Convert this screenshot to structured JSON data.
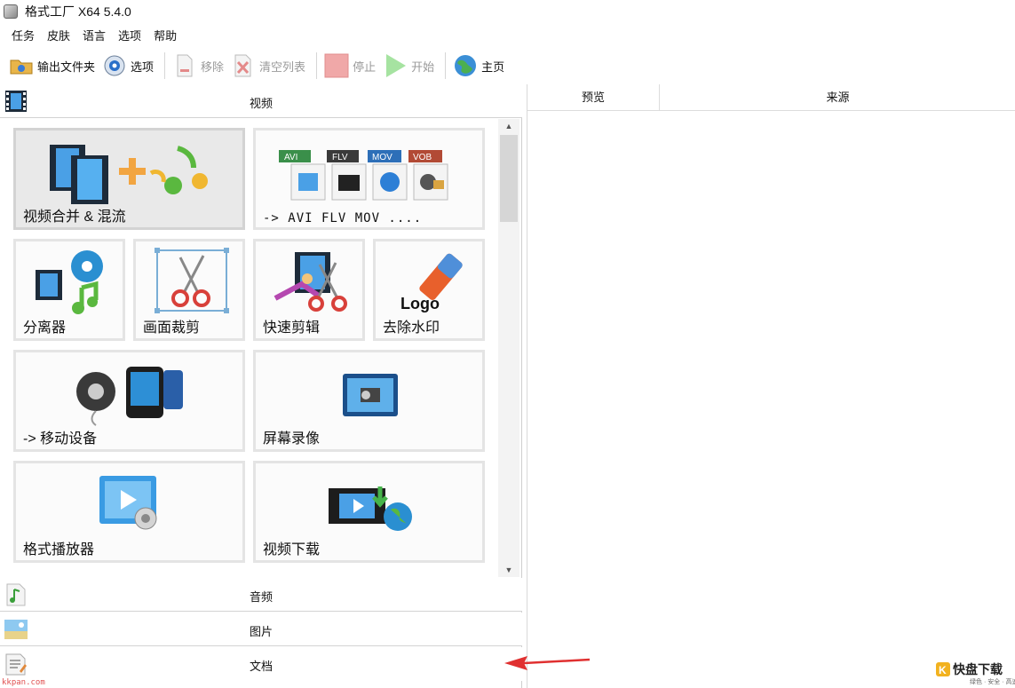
{
  "window": {
    "title": "格式工厂 X64 5.4.0"
  },
  "menu": [
    "任务",
    "皮肤",
    "语言",
    "选项",
    "帮助"
  ],
  "toolbar": {
    "output_folder": "输出文件夹",
    "options": "选项",
    "remove": "移除",
    "clear_list": "清空列表",
    "stop": "停止",
    "start": "开始",
    "home": "主页"
  },
  "sections": {
    "video": "视频",
    "audio": "音频",
    "image": "图片",
    "document": "文档"
  },
  "tiles": {
    "merge": "视频合并 & 混流",
    "formats": "-> AVI FLV MOV ....",
    "format_badges": [
      "AVI",
      "FLV",
      "MOV",
      "VOB"
    ],
    "splitter": "分离器",
    "crop": "画面裁剪",
    "quick_cut": "快速剪辑",
    "remove_watermark": "去除水印",
    "logo_text": "Logo",
    "mobile": "-> 移动设备",
    "screen_record": "屏幕录像",
    "player": "格式播放器",
    "downloader": "视频下载"
  },
  "table": {
    "columns": [
      "预览",
      "来源"
    ]
  },
  "watermarks": {
    "left": "kkpan.com",
    "right_main": "快盘下载",
    "right_k": "K",
    "right_sub": "绿色 · 安全 · 高速"
  },
  "colors": {
    "accent_arrow": "#e03030",
    "selected_tile": "#e9e9e9"
  }
}
